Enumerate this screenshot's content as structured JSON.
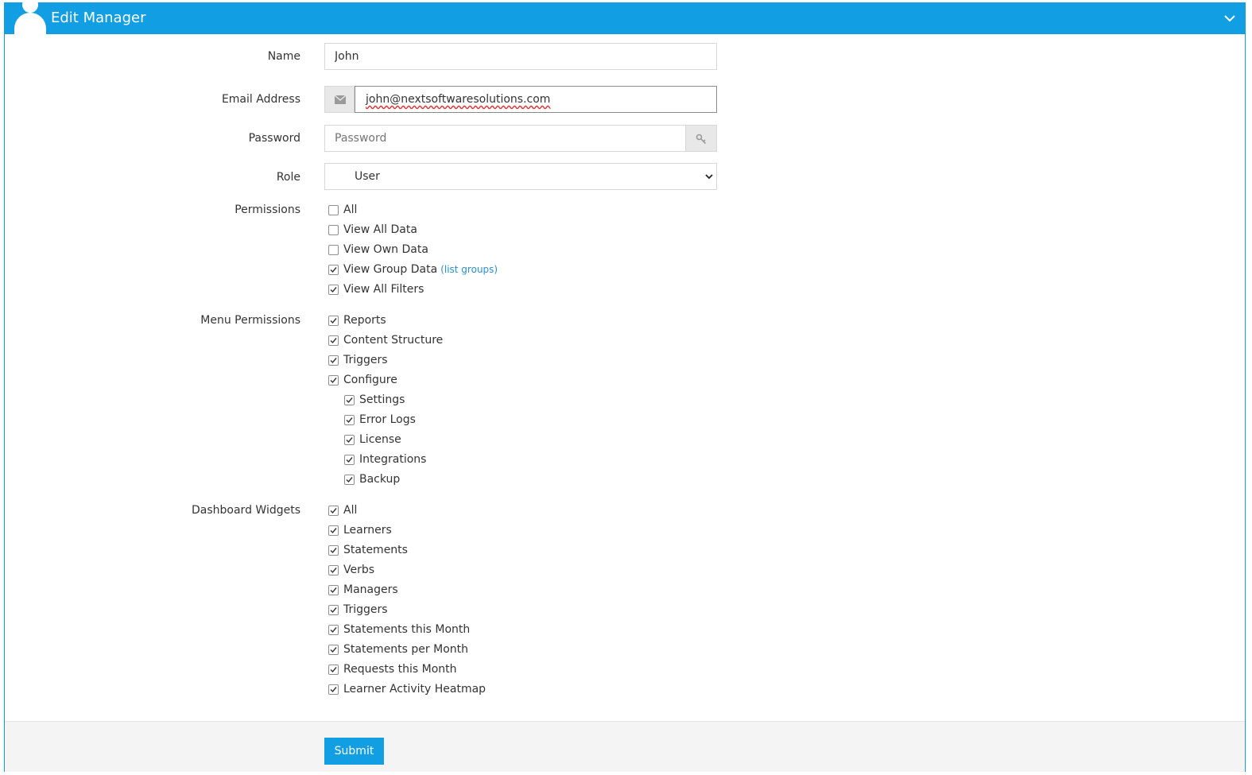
{
  "header": {
    "title": "Edit Manager"
  },
  "form": {
    "name": {
      "label": "Name",
      "value": "John"
    },
    "email": {
      "label": "Email Address",
      "value": "john@nextsoftwaresolutions.com"
    },
    "password": {
      "label": "Password",
      "placeholder": "Password"
    },
    "role": {
      "label": "Role",
      "value": "User"
    }
  },
  "permissions": {
    "label": "Permissions",
    "items": [
      {
        "label": "All",
        "checked": false
      },
      {
        "label": "View All Data",
        "checked": false
      },
      {
        "label": "View Own Data",
        "checked": false
      },
      {
        "label": "View Group Data",
        "checked": true,
        "link": "(list groups)"
      },
      {
        "label": "View All Filters",
        "checked": true
      }
    ]
  },
  "menu_permissions": {
    "label": "Menu Permissions",
    "items": [
      {
        "label": "Reports",
        "checked": true
      },
      {
        "label": "Content Structure",
        "checked": true
      },
      {
        "label": "Triggers",
        "checked": true
      },
      {
        "label": "Configure",
        "checked": true
      },
      {
        "label": "Settings",
        "checked": true,
        "indent": true
      },
      {
        "label": "Error Logs",
        "checked": true,
        "indent": true
      },
      {
        "label": "License",
        "checked": true,
        "indent": true
      },
      {
        "label": "Integrations",
        "checked": true,
        "indent": true
      },
      {
        "label": "Backup",
        "checked": true,
        "indent": true
      }
    ]
  },
  "dashboard_widgets": {
    "label": "Dashboard Widgets",
    "items": [
      {
        "label": "All",
        "checked": true
      },
      {
        "label": "Learners",
        "checked": true
      },
      {
        "label": "Statements",
        "checked": true
      },
      {
        "label": "Verbs",
        "checked": true
      },
      {
        "label": "Managers",
        "checked": true
      },
      {
        "label": "Triggers",
        "checked": true
      },
      {
        "label": "Statements this Month",
        "checked": true
      },
      {
        "label": "Statements per Month",
        "checked": true
      },
      {
        "label": "Requests this Month",
        "checked": true
      },
      {
        "label": "Learner Activity Heatmap",
        "checked": true
      }
    ]
  },
  "footer": {
    "submit_label": "Submit"
  },
  "icons": {
    "avatar": "user-avatar-icon",
    "collapse": "chevron-down-icon",
    "email": "envelope-icon",
    "password": "key-icon",
    "select": "chevron-down-icon"
  },
  "colors": {
    "accent": "#119ee3",
    "link": "#2a8fd0"
  }
}
